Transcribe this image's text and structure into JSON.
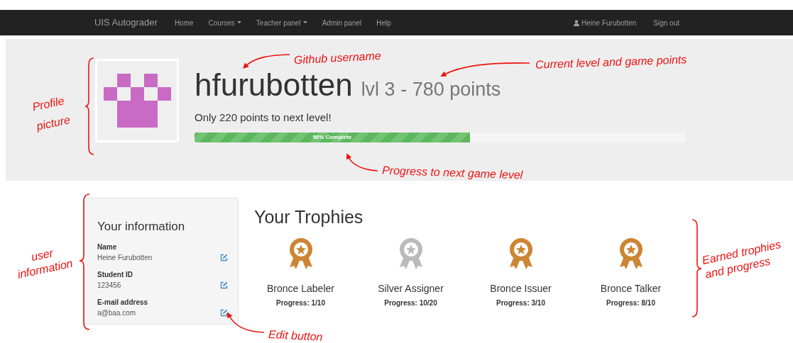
{
  "navbar": {
    "brand": "UIS Autograder",
    "items": [
      {
        "label": "Home",
        "dropdown": false
      },
      {
        "label": "Courses",
        "dropdown": true
      },
      {
        "label": "Teacher panel",
        "dropdown": true
      },
      {
        "label": "Admin panel",
        "dropdown": false
      },
      {
        "label": "Help",
        "dropdown": false
      }
    ],
    "user": "Heine Furubotten",
    "sign_out": "Sign out"
  },
  "profile": {
    "username": "hfurubotten",
    "level_points": "lvl 3 - 780 points",
    "next_level": "Only 220 points to next level!",
    "progress": {
      "level": 0.56,
      "label": "56% Complete"
    }
  },
  "info": {
    "title": "Your information",
    "fields": [
      {
        "label": "Name",
        "value": "Heine Furubotten"
      },
      {
        "label": "Student ID",
        "value": "123456"
      },
      {
        "label": "E-mail address",
        "value": "a@baa.com"
      }
    ]
  },
  "trophies": {
    "title": "Your Trophies",
    "items": [
      {
        "name": "Bronce Labeler",
        "progress": "Progress: 1/10",
        "color": "#cd8533"
      },
      {
        "name": "Silver Assigner",
        "progress": "Progress: 10/20",
        "color": "#bbbbbb"
      },
      {
        "name": "Bronce Issuer",
        "progress": "Progress: 3/10",
        "color": "#cd8533"
      },
      {
        "name": "Bronce Talker",
        "progress": "Progress: 8/10",
        "color": "#cd8533"
      }
    ]
  },
  "annotations": [
    "Github username",
    "Current level and game points",
    "Profile picture",
    "Progress to next game level",
    "user information",
    "Earned trophies and progress",
    "Edit button"
  ]
}
